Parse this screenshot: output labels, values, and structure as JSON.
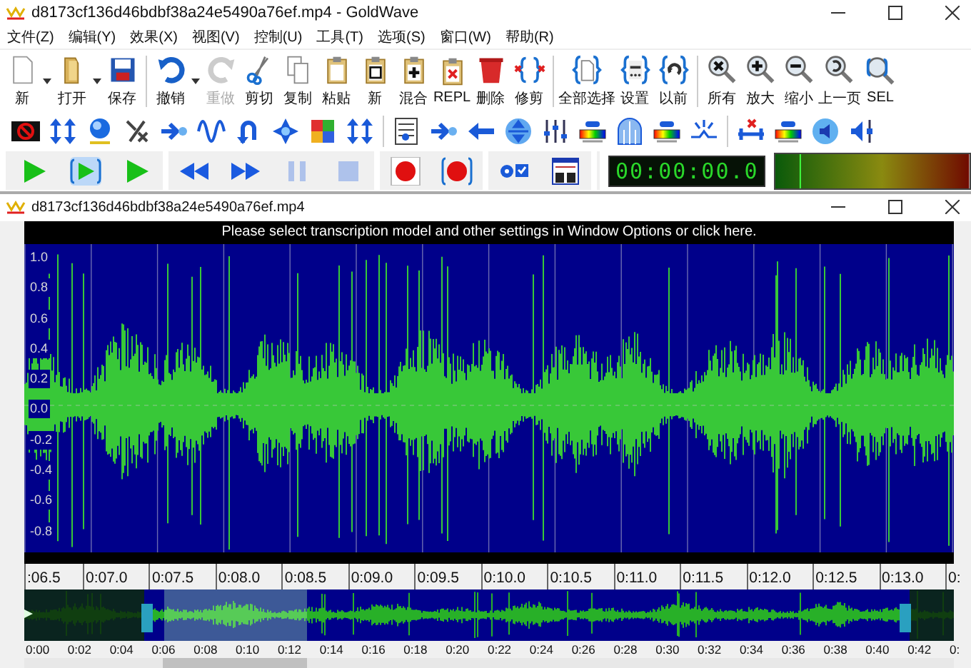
{
  "window": {
    "title": "d8173cf136d46bdbf38a24e5490a76ef.mp4 - GoldWave"
  },
  "menu": [
    {
      "label": "文件(Z)"
    },
    {
      "label": "编辑(Y)"
    },
    {
      "label": "效果(X)"
    },
    {
      "label": "视图(V)"
    },
    {
      "label": "控制(U)"
    },
    {
      "label": "工具(T)"
    },
    {
      "label": "选项(S)"
    },
    {
      "label": "窗口(W)"
    },
    {
      "label": "帮助(R)"
    }
  ],
  "toolbar_groups": [
    [
      {
        "label": "新",
        "kind": "page",
        "dropdown": true,
        "disabled": false
      },
      {
        "label": "打开",
        "kind": "folder",
        "dropdown": true,
        "disabled": false
      },
      {
        "label": "保存",
        "kind": "save",
        "dropdown": false,
        "disabled": false
      }
    ],
    [
      {
        "label": "撤销",
        "kind": "undo",
        "dropdown": true,
        "disabled": false
      },
      {
        "label": "重做",
        "kind": "redo",
        "dropdown": false,
        "disabled": true
      },
      {
        "label": "剪切",
        "kind": "scissors",
        "dropdown": false,
        "disabled": false
      },
      {
        "label": "复制",
        "kind": "copy",
        "dropdown": false,
        "disabled": false
      },
      {
        "label": "粘贴",
        "kind": "clipboard",
        "dropdown": false,
        "disabled": false
      },
      {
        "label": "新",
        "kind": "clipboard-window",
        "dropdown": false,
        "disabled": false
      },
      {
        "label": "混合",
        "kind": "clipboard-plus",
        "dropdown": false,
        "disabled": false
      },
      {
        "label": "REPL",
        "kind": "clipboard-cross",
        "dropdown": false,
        "disabled": false
      },
      {
        "label": "删除",
        "kind": "bin",
        "dropdown": false,
        "disabled": false
      },
      {
        "label": "修剪",
        "kind": "trim",
        "dropdown": false,
        "disabled": false
      }
    ],
    [
      {
        "label": "全部选择",
        "kind": "select-page",
        "dropdown": false,
        "disabled": false
      },
      {
        "label": "设置",
        "kind": "select-dots",
        "dropdown": false,
        "disabled": false
      },
      {
        "label": "以前",
        "kind": "select-undo",
        "dropdown": false,
        "disabled": false
      }
    ],
    [
      {
        "label": "所有",
        "kind": "zoom-cross",
        "dropdown": false,
        "disabled": false
      },
      {
        "label": "放大",
        "kind": "zoom-plus",
        "dropdown": false,
        "disabled": false
      },
      {
        "label": "缩小",
        "kind": "zoom-minus",
        "dropdown": false,
        "disabled": false
      },
      {
        "label": "上一页",
        "kind": "zoom-back",
        "dropdown": false,
        "disabled": false
      },
      {
        "label": "SEL",
        "kind": "zoom-bracket",
        "dropdown": false,
        "disabled": false
      }
    ]
  ],
  "transport_groups": [
    [
      {
        "kind": "play",
        "disabled": false
      },
      {
        "kind": "play-bracket",
        "disabled": false
      },
      {
        "kind": "play",
        "disabled": false
      }
    ],
    [
      {
        "kind": "rewind",
        "disabled": false
      },
      {
        "kind": "forward",
        "disabled": false
      },
      {
        "kind": "pause",
        "disabled": true
      },
      {
        "kind": "stop",
        "disabled": true
      }
    ],
    [
      {
        "kind": "record",
        "disabled": false
      },
      {
        "kind": "record-bracket",
        "disabled": false
      }
    ],
    [
      {
        "kind": "options",
        "disabled": false
      },
      {
        "kind": "window",
        "disabled": false
      }
    ]
  ],
  "time_display": "00:00:00.0",
  "document": {
    "title": "d8173cf136d46bdbf38a24e5490a76ef.mp4",
    "banner": "Please select transcription model and other settings in Window Options or click here.",
    "amplitude_labels": [
      "1.0",
      "0.8",
      "0.6",
      "0.4",
      "0.2",
      "0.0",
      "-0.2",
      "-0.4",
      "-0.6",
      "-0.8"
    ],
    "time_labels": [
      ":06.5",
      "0:07.0",
      "0:07.5",
      "0:08.0",
      "0:08.5",
      "0:09.0",
      "0:09.5",
      "0:10.0",
      "0:10.5",
      "0:11.0",
      "0:11.5",
      "0:12.0",
      "0:12.5",
      "0:13.0",
      "0:"
    ],
    "overview_labels": [
      "0:00",
      "0:02",
      "0:04",
      "0:06",
      "0:08",
      "0:10",
      "0:12",
      "0:14",
      "0:16",
      "0:18",
      "0:20",
      "0:22",
      "0:24",
      "0:26",
      "0:28",
      "0:30",
      "0:32",
      "0:34",
      "0:36",
      "0:38",
      "0:40",
      "0:42",
      "0:"
    ]
  }
}
